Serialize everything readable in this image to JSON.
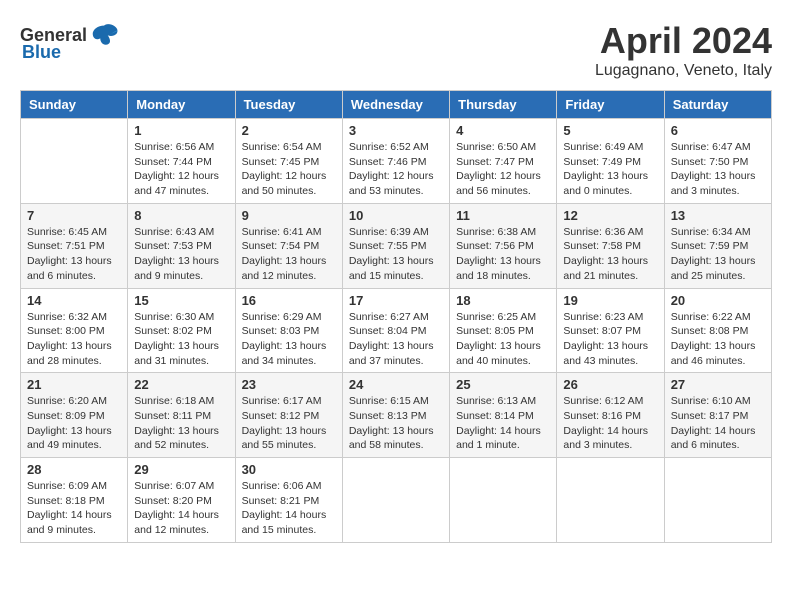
{
  "header": {
    "logo_general": "General",
    "logo_blue": "Blue",
    "month": "April 2024",
    "location": "Lugagnano, Veneto, Italy"
  },
  "calendar": {
    "days_of_week": [
      "Sunday",
      "Monday",
      "Tuesday",
      "Wednesday",
      "Thursday",
      "Friday",
      "Saturday"
    ],
    "weeks": [
      [
        {
          "day": "",
          "info": ""
        },
        {
          "day": "1",
          "info": "Sunrise: 6:56 AM\nSunset: 7:44 PM\nDaylight: 12 hours\nand 47 minutes."
        },
        {
          "day": "2",
          "info": "Sunrise: 6:54 AM\nSunset: 7:45 PM\nDaylight: 12 hours\nand 50 minutes."
        },
        {
          "day": "3",
          "info": "Sunrise: 6:52 AM\nSunset: 7:46 PM\nDaylight: 12 hours\nand 53 minutes."
        },
        {
          "day": "4",
          "info": "Sunrise: 6:50 AM\nSunset: 7:47 PM\nDaylight: 12 hours\nand 56 minutes."
        },
        {
          "day": "5",
          "info": "Sunrise: 6:49 AM\nSunset: 7:49 PM\nDaylight: 13 hours\nand 0 minutes."
        },
        {
          "day": "6",
          "info": "Sunrise: 6:47 AM\nSunset: 7:50 PM\nDaylight: 13 hours\nand 3 minutes."
        }
      ],
      [
        {
          "day": "7",
          "info": "Sunrise: 6:45 AM\nSunset: 7:51 PM\nDaylight: 13 hours\nand 6 minutes."
        },
        {
          "day": "8",
          "info": "Sunrise: 6:43 AM\nSunset: 7:53 PM\nDaylight: 13 hours\nand 9 minutes."
        },
        {
          "day": "9",
          "info": "Sunrise: 6:41 AM\nSunset: 7:54 PM\nDaylight: 13 hours\nand 12 minutes."
        },
        {
          "day": "10",
          "info": "Sunrise: 6:39 AM\nSunset: 7:55 PM\nDaylight: 13 hours\nand 15 minutes."
        },
        {
          "day": "11",
          "info": "Sunrise: 6:38 AM\nSunset: 7:56 PM\nDaylight: 13 hours\nand 18 minutes."
        },
        {
          "day": "12",
          "info": "Sunrise: 6:36 AM\nSunset: 7:58 PM\nDaylight: 13 hours\nand 21 minutes."
        },
        {
          "day": "13",
          "info": "Sunrise: 6:34 AM\nSunset: 7:59 PM\nDaylight: 13 hours\nand 25 minutes."
        }
      ],
      [
        {
          "day": "14",
          "info": "Sunrise: 6:32 AM\nSunset: 8:00 PM\nDaylight: 13 hours\nand 28 minutes."
        },
        {
          "day": "15",
          "info": "Sunrise: 6:30 AM\nSunset: 8:02 PM\nDaylight: 13 hours\nand 31 minutes."
        },
        {
          "day": "16",
          "info": "Sunrise: 6:29 AM\nSunset: 8:03 PM\nDaylight: 13 hours\nand 34 minutes."
        },
        {
          "day": "17",
          "info": "Sunrise: 6:27 AM\nSunset: 8:04 PM\nDaylight: 13 hours\nand 37 minutes."
        },
        {
          "day": "18",
          "info": "Sunrise: 6:25 AM\nSunset: 8:05 PM\nDaylight: 13 hours\nand 40 minutes."
        },
        {
          "day": "19",
          "info": "Sunrise: 6:23 AM\nSunset: 8:07 PM\nDaylight: 13 hours\nand 43 minutes."
        },
        {
          "day": "20",
          "info": "Sunrise: 6:22 AM\nSunset: 8:08 PM\nDaylight: 13 hours\nand 46 minutes."
        }
      ],
      [
        {
          "day": "21",
          "info": "Sunrise: 6:20 AM\nSunset: 8:09 PM\nDaylight: 13 hours\nand 49 minutes."
        },
        {
          "day": "22",
          "info": "Sunrise: 6:18 AM\nSunset: 8:11 PM\nDaylight: 13 hours\nand 52 minutes."
        },
        {
          "day": "23",
          "info": "Sunrise: 6:17 AM\nSunset: 8:12 PM\nDaylight: 13 hours\nand 55 minutes."
        },
        {
          "day": "24",
          "info": "Sunrise: 6:15 AM\nSunset: 8:13 PM\nDaylight: 13 hours\nand 58 minutes."
        },
        {
          "day": "25",
          "info": "Sunrise: 6:13 AM\nSunset: 8:14 PM\nDaylight: 14 hours\nand 1 minute."
        },
        {
          "day": "26",
          "info": "Sunrise: 6:12 AM\nSunset: 8:16 PM\nDaylight: 14 hours\nand 3 minutes."
        },
        {
          "day": "27",
          "info": "Sunrise: 6:10 AM\nSunset: 8:17 PM\nDaylight: 14 hours\nand 6 minutes."
        }
      ],
      [
        {
          "day": "28",
          "info": "Sunrise: 6:09 AM\nSunset: 8:18 PM\nDaylight: 14 hours\nand 9 minutes."
        },
        {
          "day": "29",
          "info": "Sunrise: 6:07 AM\nSunset: 8:20 PM\nDaylight: 14 hours\nand 12 minutes."
        },
        {
          "day": "30",
          "info": "Sunrise: 6:06 AM\nSunset: 8:21 PM\nDaylight: 14 hours\nand 15 minutes."
        },
        {
          "day": "",
          "info": ""
        },
        {
          "day": "",
          "info": ""
        },
        {
          "day": "",
          "info": ""
        },
        {
          "day": "",
          "info": ""
        }
      ]
    ]
  }
}
